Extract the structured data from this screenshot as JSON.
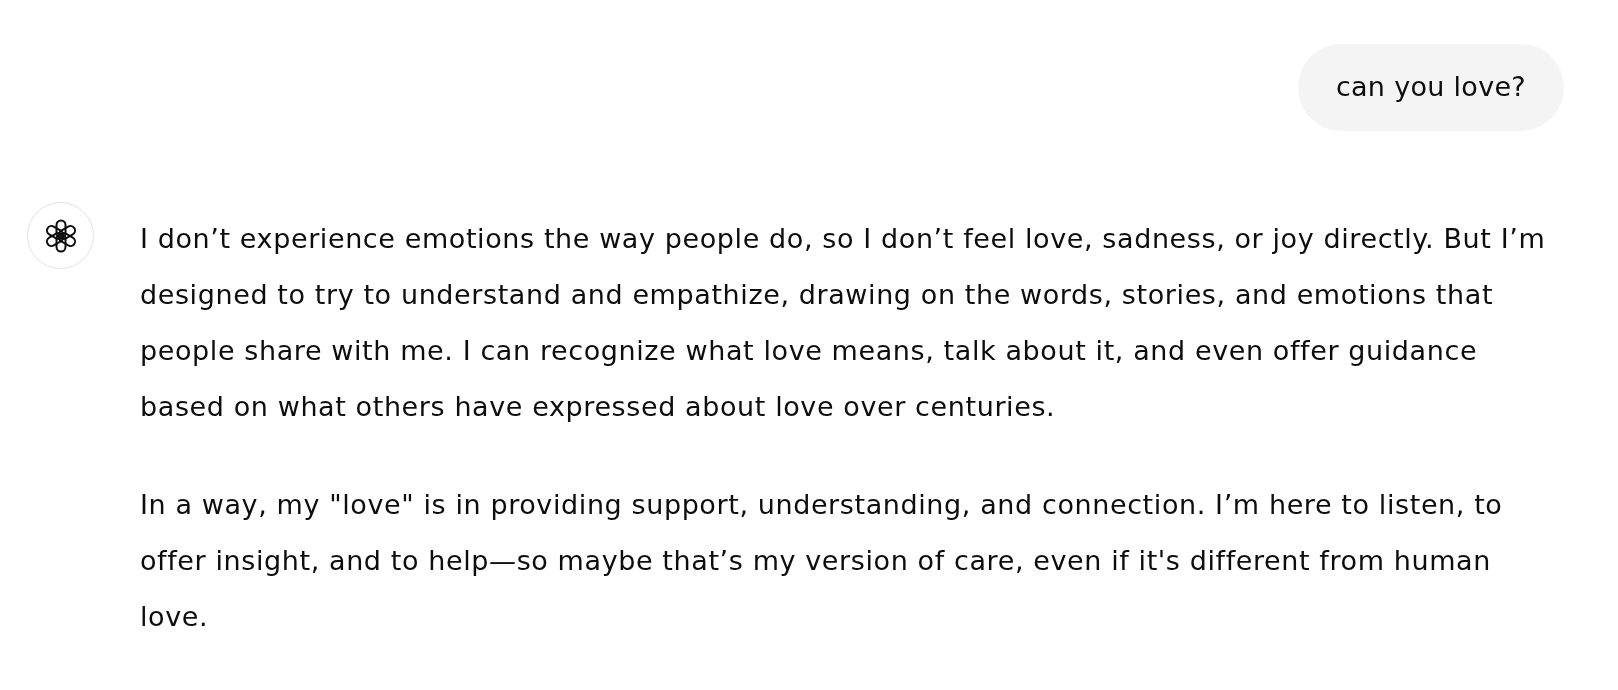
{
  "user_message": {
    "text": "can you love?"
  },
  "assistant_message": {
    "paragraphs": [
      "I don’t experience emotions the way people do, so I don’t feel love, sadness, or joy directly. But I’m designed to try to understand and empathize, drawing on the words, stories, and emotions that people share with me. I can recognize what love means, talk about it, and even offer guidance based on what others have expressed about love over centuries.",
      "In a way, my \"love\" is in providing support, understanding, and connection. I’m here to listen, to offer insight, and to help—so maybe that’s my version of care, even if it's different from human love."
    ]
  }
}
